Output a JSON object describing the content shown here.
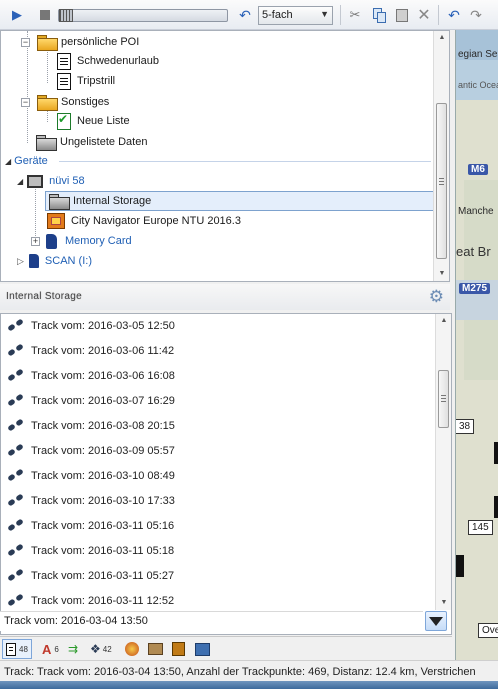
{
  "toolbar": {
    "play_icon": "play-icon",
    "stop_icon": "stop-icon",
    "speed_value": "5-fach",
    "colors": {
      "accent": "#1f5fb4"
    }
  },
  "tree": {
    "items": [
      {
        "label": "persönliche POI",
        "icon": "folder-icon"
      },
      {
        "label": "Schwedenurlaub",
        "icon": "document-icon"
      },
      {
        "label": "Tripstrill",
        "icon": "document-icon"
      },
      {
        "label": "Sonstiges",
        "icon": "folder-icon"
      },
      {
        "label": "Neue Liste",
        "icon": "checked-document-icon"
      },
      {
        "label": "Ungelistete Daten",
        "icon": "folder-icon"
      }
    ],
    "devices_section": "Geräte",
    "device_name": "nüvi 58",
    "device_children": [
      {
        "label": "Internal Storage",
        "selected": true
      },
      {
        "label": "City Navigator Europe NTU 2016.3"
      },
      {
        "label": "Memory Card"
      }
    ],
    "scan_drive": "SCAN (I:)"
  },
  "storage": {
    "title": "Internal Storage"
  },
  "tracks": [
    "Track vom: 2016-03-05 12:50",
    "Track vom: 2016-03-06 11:42",
    "Track vom: 2016-03-06 16:08",
    "Track vom: 2016-03-07 16:29",
    "Track vom: 2016-03-08 20:15",
    "Track vom: 2016-03-09 05:57",
    "Track vom: 2016-03-10 08:49",
    "Track vom: 2016-03-10 17:33",
    "Track vom: 2016-03-11 05:16",
    "Track vom: 2016-03-11 05:18",
    "Track vom: 2016-03-11 05:27",
    "Track vom: 2016-03-11 12:52"
  ],
  "selected_track": "Track vom: 2016-03-04 13:50",
  "tabs": [
    {
      "count": "48"
    },
    {
      "count": "6"
    },
    {
      "count": ""
    },
    {
      "count": "42"
    }
  ],
  "status": "Track: Track vom: 2016-03-04 13:50, Anzahl der Trackpunkte: 469, Distanz: 12.4 km, Verstrichen",
  "map": {
    "labels": [
      "egian Sea",
      "antic Ocean",
      "Manche",
      "eat Br",
      "Ove"
    ],
    "roads": [
      "M6",
      "M275"
    ],
    "numbers": [
      "38",
      "145"
    ]
  }
}
